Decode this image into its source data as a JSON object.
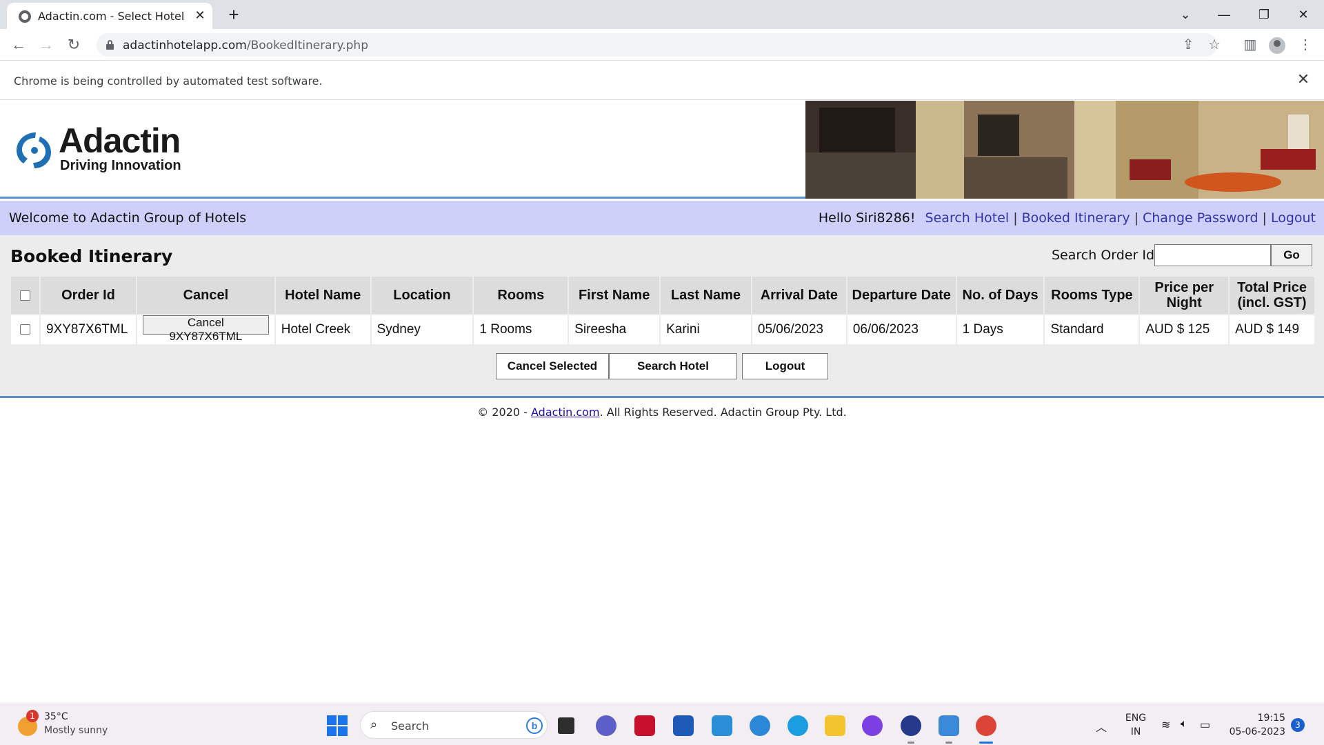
{
  "browser": {
    "tab_title": "Adactin.com - Select Hotel",
    "url_host": "adactinhotelapp.com",
    "url_path": "/BookedItinerary.php",
    "infobar_text": "Chrome is being controlled by automated test software."
  },
  "header": {
    "logo_title": "Adactin",
    "logo_tagline": "Driving Innovation"
  },
  "welcome_bar": {
    "welcome_text": "Welcome to Adactin Group of Hotels",
    "greeting": "Hello Siri8286!",
    "links": [
      "Search Hotel",
      "Booked Itinerary",
      "Change Password",
      "Logout"
    ]
  },
  "main": {
    "title": "Booked Itinerary",
    "search_label": "Search Order Id",
    "search_value": "",
    "go_label": "Go",
    "columns": [
      "Order Id",
      "Cancel",
      "Hotel Name",
      "Location",
      "Rooms",
      "First Name",
      "Last Name",
      "Arrival Date",
      "Departure Date",
      "No. of Days",
      "Rooms Type",
      "Price per Night",
      "Total Price (incl. GST)"
    ],
    "rows": [
      {
        "order_id": "9XY87X6TML",
        "cancel_label": "Cancel 9XY87X6TML",
        "hotel_name": "Hotel Creek",
        "location": "Sydney",
        "rooms": "1 Rooms",
        "first_name": "Sireesha",
        "last_name": "Karini",
        "arrival_date": "05/06/2023",
        "departure_date": "06/06/2023",
        "days": "1 Days",
        "room_type": "Standard",
        "price_per_night": "AUD $ 125",
        "total_price": "AUD $ 149"
      }
    ],
    "buttons": {
      "cancel_selected": "Cancel Selected",
      "search_hotel": "Search Hotel",
      "logout": "Logout"
    }
  },
  "footer": {
    "prefix": "© 2020 - ",
    "link": "Adactin.com",
    "suffix": ". All Rights Reserved. Adactin Group Pty. Ltd."
  },
  "taskbar": {
    "weather_temp": "35°C",
    "weather_desc": "Mostly sunny",
    "weather_badge": "1",
    "search_placeholder": "Search",
    "lang_1": "ENG",
    "lang_2": "IN",
    "time": "19:15",
    "date": "05-06-2023",
    "notification_count": "3"
  },
  "colors": {
    "welcome_bar": "#cfd0f9",
    "link": "#3333a8",
    "divider": "#5b8fc7",
    "logo_blue": "#1f6fb5"
  }
}
